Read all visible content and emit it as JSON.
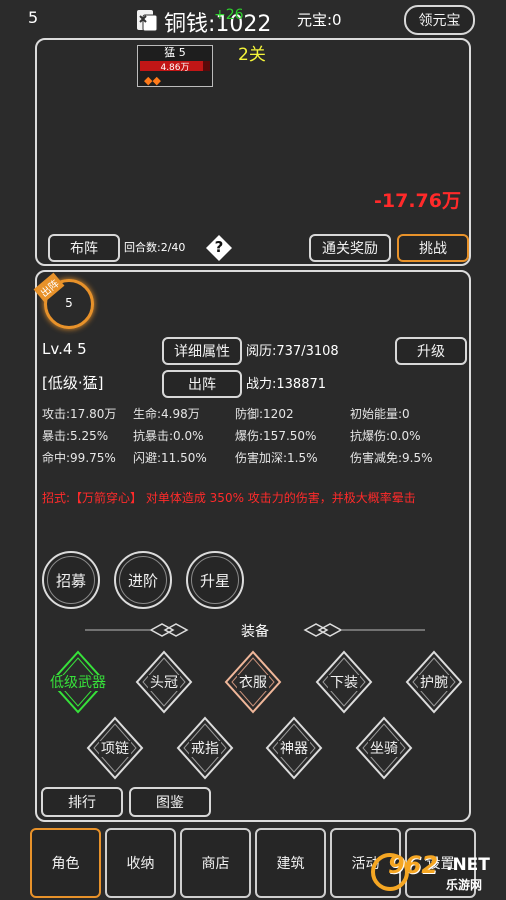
{
  "topbar": {
    "level_counter": "5",
    "coins_label": "铜钱:1022",
    "coins_gain": "+26",
    "yuanbao_label": "元宝:0",
    "claim_yuanbao": "领元宝"
  },
  "battle": {
    "stage": "2关",
    "enemy_name": "猛 5",
    "enemy_hp": "4.86万",
    "enemy_hp_fraction": 0.9,
    "damage_popup": "-17.76万",
    "formation_button": "布阵",
    "round_counter": "回合数:2/40",
    "help_icon_glyph": "?",
    "clear_reward_button": "通关奖励",
    "challenge_button": "挑战"
  },
  "hero": {
    "badge": "出阵",
    "avatar_number": "5",
    "level": "Lv.4 5",
    "grade_name": "[低级·猛]",
    "detail_button": "详细属性",
    "deploy_button": "出阵",
    "experience": "阅历:737/3108",
    "upgrade_button": "升级",
    "power": "战力:138871",
    "stats": [
      [
        "攻击:17.80万",
        "生命:4.98万",
        "防御:1202",
        "初始能量:0"
      ],
      [
        "暴击:5.25%",
        "抗暴击:0.0%",
        "爆伤:157.50%",
        "抗爆伤:0.0%"
      ],
      [
        "命中:99.75%",
        "闪避:11.50%",
        "伤害加深:1.5%",
        "伤害减免:9.5%"
      ]
    ],
    "skill_text": "招式:【万箭穿心】 对单体造成 350% 攻击力的伤害，并极大概率晕击",
    "actions": [
      "招募",
      "进阶",
      "升星"
    ]
  },
  "equipment": {
    "title": "装备",
    "row1": [
      "低级武器",
      "头冠",
      "衣服",
      "下装",
      "护腕"
    ],
    "row2": [
      "项链",
      "戒指",
      "神器",
      "坐骑"
    ]
  },
  "footer_buttons": {
    "rank": "排行",
    "codex": "图鉴"
  },
  "tabs": [
    "角色",
    "收纳",
    "商店",
    "建筑",
    "活动",
    "设置"
  ],
  "watermark": {
    "logo": "962",
    "domain": ".NET",
    "site": "乐游网"
  },
  "colors": {
    "accent_orange": "#e8922a",
    "damage_red": "#ff2a2a",
    "gain_green": "#2dd12d",
    "stage_yellow": "#f5f53a",
    "weapon_green": "#37e23a"
  }
}
